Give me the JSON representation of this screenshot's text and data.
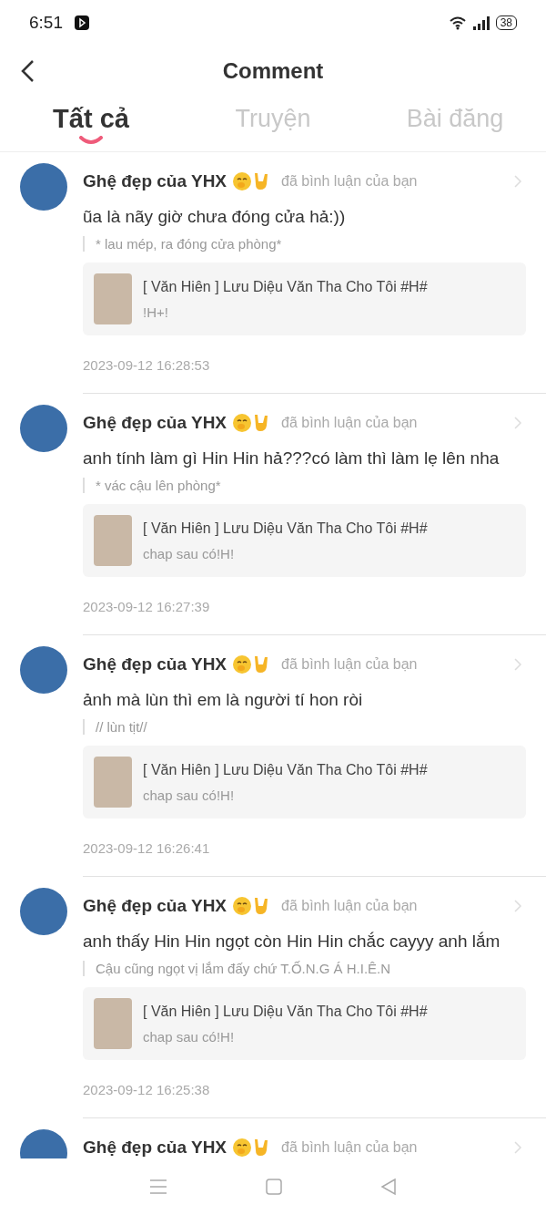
{
  "status_bar": {
    "time": "6:51",
    "battery": "38"
  },
  "header": {
    "title": "Comment"
  },
  "tabs": [
    {
      "label": "Tất cả",
      "selected": true
    },
    {
      "label": "Truyện",
      "selected": false
    },
    {
      "label": "Bài đăng",
      "selected": false
    }
  ],
  "comments": [
    {
      "user": "Ghệ đẹp của YHX",
      "action": "đã bình luận của bạn",
      "text": "ũa là nãy giờ chưa đóng cửa hả:))",
      "quote": "* lau mép, ra đóng cửa phòng*",
      "story_title": "[ Văn Hiên ] Lưu Diệu Văn Tha Cho Tôi #H#",
      "story_comment": "!H+!",
      "time": "2023-09-12 16:28:53"
    },
    {
      "user": "Ghệ đẹp của YHX",
      "action": "đã bình luận của bạn",
      "text": "anh tính làm gì Hin Hin hả???có làm thì làm lẹ lên nha",
      "quote": "* vác cậu lên phòng*",
      "story_title": "[ Văn Hiên ] Lưu Diệu Văn Tha Cho Tôi #H#",
      "story_comment": "chap sau có!H!",
      "time": "2023-09-12 16:27:39"
    },
    {
      "user": "Ghệ đẹp của YHX",
      "action": "đã bình luận của bạn",
      "text": "ảnh mà lùn thì em là người tí hon ròi",
      "quote": "// lùn tịt//",
      "story_title": "[ Văn Hiên ] Lưu Diệu Văn Tha Cho Tôi #H#",
      "story_comment": "chap sau có!H!",
      "time": "2023-09-12 16:26:41"
    },
    {
      "user": "Ghệ đẹp của YHX",
      "action": "đã bình luận của bạn",
      "text": "anh thấy Hin Hin ngọt còn Hin Hin chắc cayyy anh lắm",
      "quote": "Cậu cũng ngọt vị lắm đấy chứ T.Ố.N.G Á H.I.Ê.N",
      "story_title": "[ Văn Hiên ] Lưu Diệu Văn Tha Cho Tôi #H#",
      "story_comment": "chap sau có!H!",
      "time": "2023-09-12 16:25:38"
    },
    {
      "user": "Ghệ đẹp của YHX",
      "action": "đã bình luận của bạn"
    }
  ]
}
